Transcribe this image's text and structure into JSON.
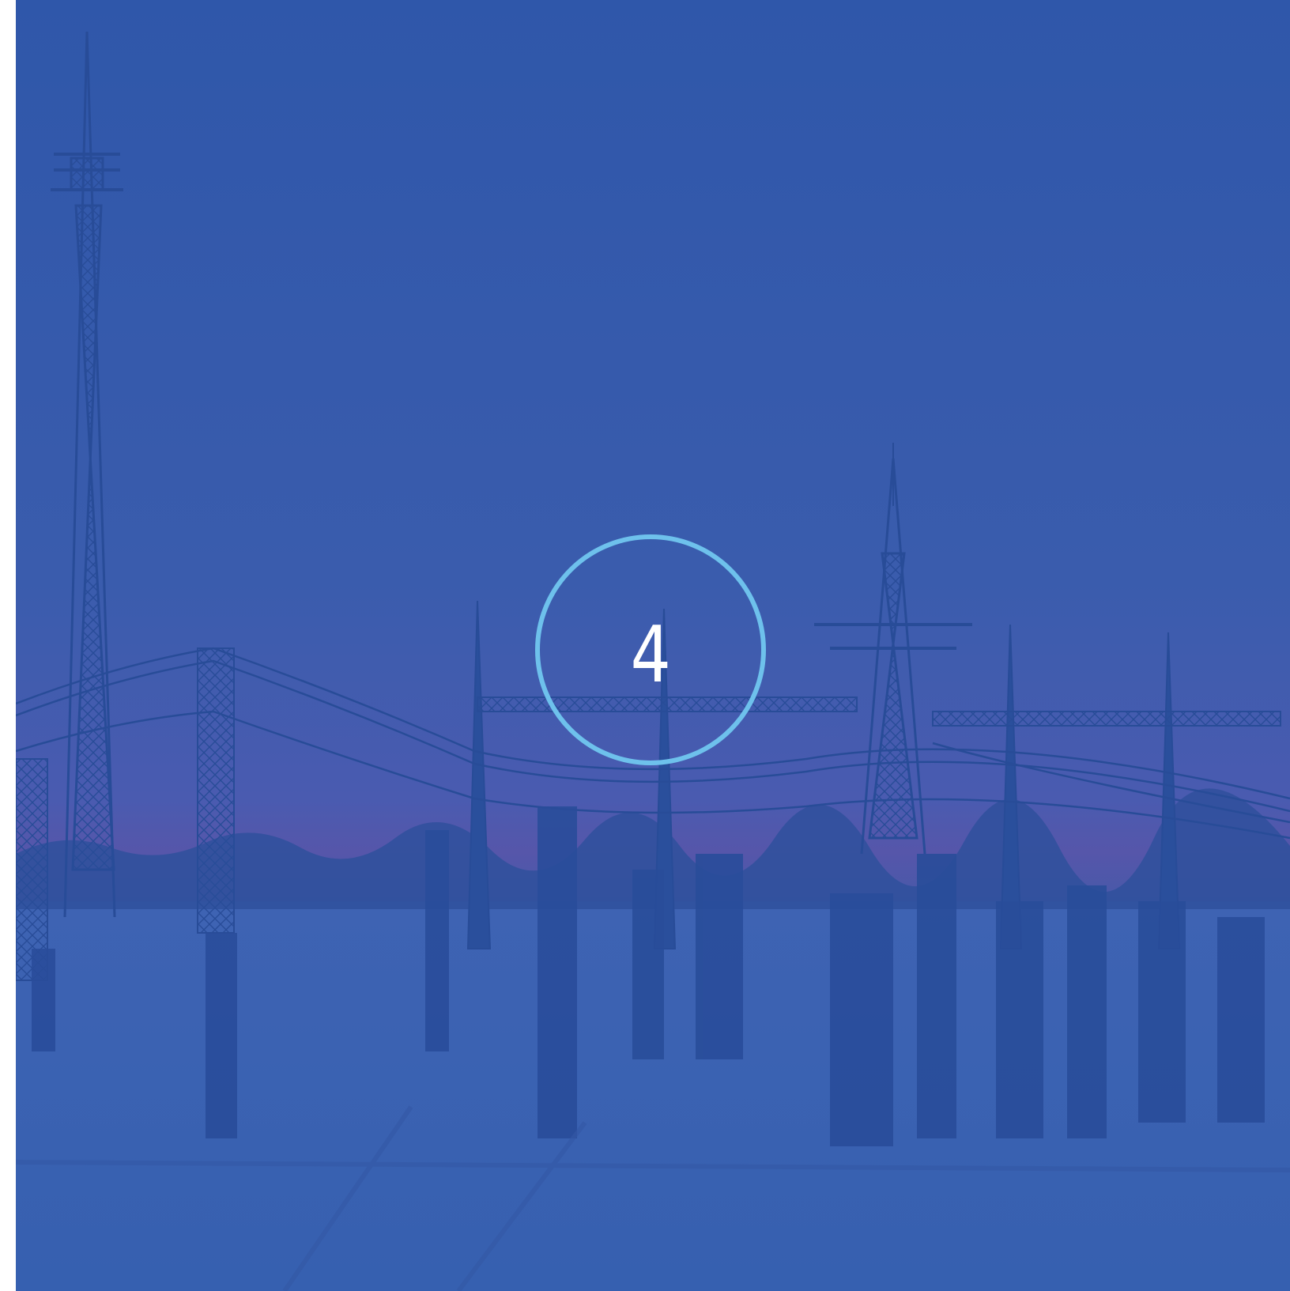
{
  "chapter": {
    "number": "4"
  },
  "colors": {
    "overlay": "#3159ac",
    "ring": "#6ec1ec",
    "number": "#ffffff",
    "horizon": "#5a55a8"
  },
  "image": {
    "subject": "electrical-substation-photo"
  }
}
